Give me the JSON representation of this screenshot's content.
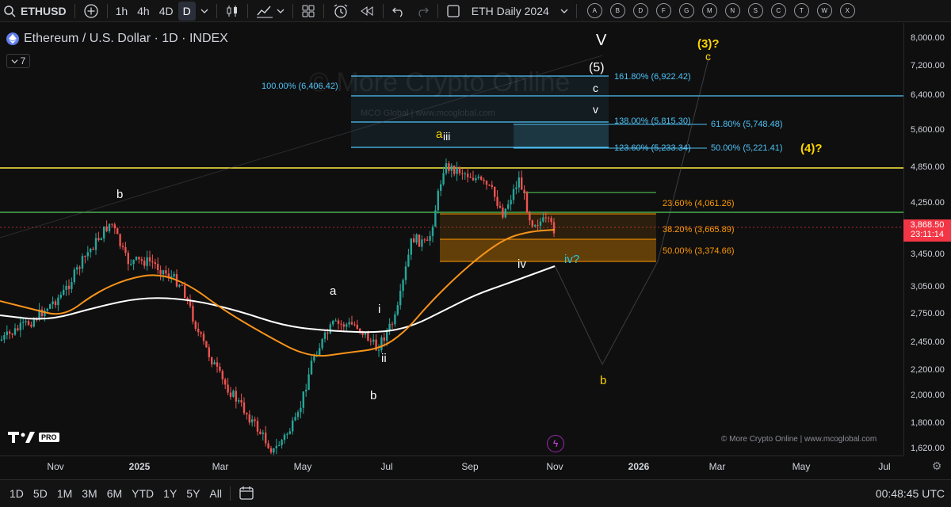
{
  "toolbar": {
    "symbol": "ETHUSD",
    "timeframes": [
      "1h",
      "4h",
      "4D",
      "D"
    ],
    "active_timeframe": "D",
    "layout_name": "ETH Daily 2024",
    "letters": [
      "A",
      "B",
      "D",
      "F",
      "G",
      "M",
      "N",
      "S",
      "C",
      "T",
      "W",
      "X"
    ]
  },
  "legend": {
    "title": "Ethereum / U.S. Dollar · 1D · INDEX",
    "collapse_count": "7"
  },
  "watermark": {
    "main": "© More Crypto Online",
    "sub": "MCO Global  |  www.mcoglobal.com"
  },
  "credit": "© More Crypto Online  |  www.mcoglobal.com",
  "price_axis": {
    "ticks": [
      "8,000.00",
      "7,200.00",
      "6,400.00",
      "5,600.00",
      "4,850.00",
      "4,250.00",
      "3,450.00",
      "3,050.00",
      "2,750.00",
      "2,450.00",
      "2,200.00",
      "2,000.00",
      "1,800.00",
      "1,620.00"
    ],
    "last_price": "3,868.50",
    "countdown": "23:11:14",
    "last_price_color": "#f23645"
  },
  "time_axis": {
    "labels": [
      "Nov",
      "2025",
      "Mar",
      "May",
      "Jul",
      "Sep",
      "Nov",
      "2026",
      "Mar",
      "May",
      "Jul"
    ]
  },
  "bottom_bar": {
    "ranges": [
      "1D",
      "5D",
      "1M",
      "3M",
      "6M",
      "YTD",
      "1Y",
      "5Y",
      "All"
    ],
    "clock": "00:48:45 UTC"
  },
  "fib_levels": {
    "upper": [
      {
        "text": "100.00% (6,406.42)",
        "color": "#4fc3f7"
      },
      {
        "text": "161.80% (6,922.42)",
        "color": "#4fc3f7"
      },
      {
        "text": "138.00% (5,815.30)",
        "color": "#4fc3f7"
      },
      {
        "text": "123.60% (5,233.34)",
        "color": "#4fc3f7"
      },
      {
        "text": "61.80% (5,748.48)",
        "color": "#4fc3f7"
      },
      {
        "text": "50.00% (5,221.41)",
        "color": "#4fc3f7"
      }
    ],
    "lower": [
      {
        "text": "23.60% (4,061.26)",
        "color": "#ff9800"
      },
      {
        "text": "38.20% (3,665.89)",
        "color": "#ff9800"
      },
      {
        "text": "50.00% (3,374.66)",
        "color": "#ff9800"
      }
    ]
  },
  "wave_labels": {
    "V": "V",
    "five": "(5)",
    "c_top": "c",
    "v": "v",
    "a": "a",
    "iii": "iii",
    "three_q": "(3)?",
    "c_yellow": "c",
    "four_q": "(4)?",
    "b_left": "b",
    "a_mid": "a",
    "i": "i",
    "ii": "ii",
    "b_low": "b",
    "iv": "iv",
    "iv_q": "iv?",
    "b_target": "b"
  },
  "colors": {
    "background": "#0f0f0f",
    "ma_orange": "#f7931a",
    "ma_white": "#ffffff",
    "yellow_line": "#ffeb3b",
    "green_line": "#4caf50",
    "fib_blue": "#4fc3f7",
    "fib_orange": "#ff9800",
    "label_yellow": "#ffd600",
    "label_teal": "#26c6da"
  }
}
